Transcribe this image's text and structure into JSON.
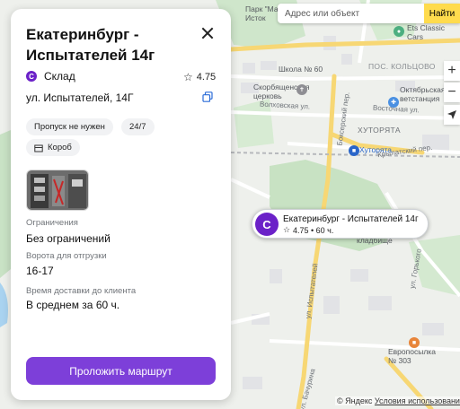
{
  "search": {
    "placeholder": "Адрес или объект",
    "button_label": "Найти"
  },
  "map": {
    "labels": {
      "park": "Парк \"Малый\nИсток",
      "ets": "Ets Classic\nCars",
      "school": "Школа № 60",
      "settlement": "ПОС. КОЛЬЦОВО",
      "church": "Скорбященская\nцерковь",
      "vet": "Октябрьская\nветстанция",
      "khutoryata": "ХУТОРЯТА",
      "stop": "Хуторята",
      "cemetery": "кладбище",
      "evroposylka": "Европосылка\n№ 303"
    },
    "streets": {
      "volkhovskaya": "Волховская ул.",
      "vostochnaya": "Восточная ул.",
      "ispytateley": "ул. Испытателей",
      "boksersky": "Боксерский пер.",
      "krylatsky": "Крылатский пер.",
      "gorkogo": "ул. Горького",
      "bachurina": "ул. Бачурина"
    }
  },
  "controls": {
    "zoom_in": "+",
    "zoom_out": "−"
  },
  "callout": {
    "logo": "С",
    "title": "Екатеринбург - Испытателей 14г",
    "star": "☆",
    "meta": "4.75 • 60 ч."
  },
  "panel": {
    "title": "Екатеринбург - Испытателей 14г",
    "brand_logo": "С",
    "type": "Склад",
    "rating": "4.75",
    "star": "☆",
    "address": "ул. Испытателей, 14Г",
    "tags": [
      "Пропуск не нужен",
      "24/7",
      "Короб"
    ],
    "restrictions_label": "Ограничения",
    "restrictions_value": "Без ограничений",
    "gate_label": "Ворота для отгрузки",
    "gate_value": "16-17",
    "delivery_label": "Время доставки до клиента",
    "delivery_value": "В среднем за 60 ч.",
    "route_button": "Проложить маршрут"
  },
  "footer": {
    "copyright": "© Яндекс",
    "terms": "Условия использования"
  },
  "colors": {
    "accent": "#7d3fd9",
    "brand": "#6b21c8",
    "search_button": "#ffdb4d"
  }
}
